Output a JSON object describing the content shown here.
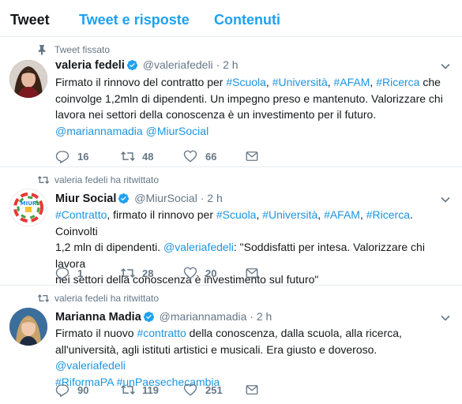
{
  "tabs": [
    "Tweet",
    "Tweet e risposte",
    "Contenuti"
  ],
  "colors": {
    "accent": "#1da1f2",
    "link": "#1b95e0",
    "muted": "#657786",
    "text": "#14171a"
  },
  "tweets": [
    {
      "context": "Tweet fissato",
      "context_icon": "pin-icon",
      "name": "valeria fedeli",
      "handle": "@valeriafedeli",
      "sep": "·",
      "time": "2 h",
      "body": [
        [
          {
            "t": "Firmato il rinnovo del contratto per "
          },
          {
            "t": "#Scuola",
            "l": 1
          },
          {
            "t": ", "
          },
          {
            "t": "#Università",
            "l": 1
          },
          {
            "t": ", "
          },
          {
            "t": "#AFAM",
            "l": 1
          },
          {
            "t": ", "
          },
          {
            "t": "#Ricerca",
            "l": 1
          },
          {
            "t": " che"
          }
        ],
        [
          {
            "t": "coinvolge 1,2mln di dipendenti. Un impegno preso e mantenuto. Valorizzare chi"
          }
        ],
        [
          {
            "t": "lavora nei settori della conoscenza è un investimento per il futuro."
          }
        ],
        [
          {
            "t": "@mariannamadia",
            "l": 1
          },
          {
            "t": " "
          },
          {
            "t": "@MiurSocial",
            "l": 1
          }
        ]
      ],
      "replies": "16",
      "retweets": "48",
      "likes": "66"
    },
    {
      "context": "valeria fedeli ha ritwittato",
      "context_icon": "retweet-icon",
      "name": "Miur Social",
      "handle": "@MiurSocial",
      "sep": "·",
      "time": "2 h",
      "body": [
        [
          {
            "t": "#Contratto",
            "l": 1
          },
          {
            "t": ", firmato il rinnovo per "
          },
          {
            "t": "#Scuola",
            "l": 1
          },
          {
            "t": ", "
          },
          {
            "t": "#Università",
            "l": 1
          },
          {
            "t": ", "
          },
          {
            "t": "#AFAM",
            "l": 1
          },
          {
            "t": ", "
          },
          {
            "t": "#Ricerca",
            "l": 1
          },
          {
            "t": ". Coinvolti"
          }
        ],
        [
          {
            "t": "1,2 mln di dipendenti. "
          },
          {
            "t": "@valeriafedeli",
            "l": 1
          },
          {
            "t": ": \"Soddisfatti per intesa. Valorizzare chi lavora"
          }
        ],
        [
          {
            "t": "nei settori della conoscenza è investimento sul futuro\""
          }
        ]
      ],
      "replies": "1",
      "retweets": "28",
      "likes": "20"
    },
    {
      "context": "valeria fedeli ha ritwittato",
      "context_icon": "retweet-icon",
      "name": "Marianna Madia",
      "handle": "@mariannamadia",
      "sep": "·",
      "time": "2 h",
      "body": [
        [
          {
            "t": "Firmato il nuovo "
          },
          {
            "t": "#contratto",
            "l": 1
          },
          {
            "t": " della conoscenza, dalla scuola, alla ricerca,"
          }
        ],
        [
          {
            "t": "all'università, agli istituti artistici e musicali. Era giusto e doveroso. "
          },
          {
            "t": "@valeriafedeli",
            "l": 1
          }
        ],
        [
          {
            "t": "#RiformaPA",
            "l": 1
          },
          {
            "t": " "
          },
          {
            "t": "#unPaesechecambia",
            "l": 1
          }
        ]
      ],
      "replies": "90",
      "retweets": "119",
      "likes": "251"
    }
  ]
}
